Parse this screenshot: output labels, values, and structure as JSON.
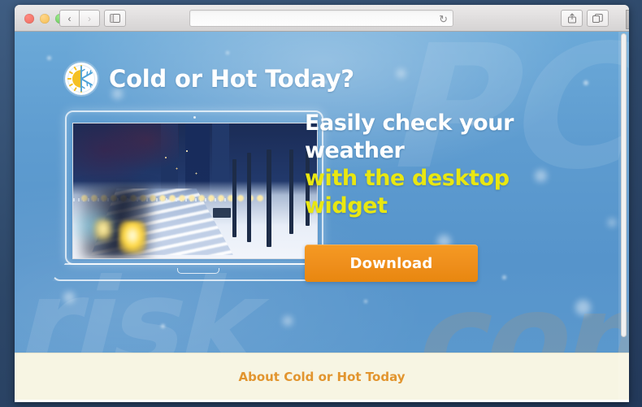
{
  "browser": {
    "window_controls": {
      "close": "close",
      "minimize": "minimize",
      "maximize": "maximize"
    },
    "back_label": "‹",
    "forward_label": "›",
    "sidebar_icon": "sidebar-icon",
    "address_value": "",
    "address_placeholder": "",
    "reload_label": "↻",
    "share_icon": "share-icon",
    "tabs_icon": "tabs-overview-icon",
    "new_tab_label": "+"
  },
  "page": {
    "brand": {
      "title": "Cold or Hot Today?",
      "logo_name": "sun-snowflake-logo"
    },
    "hero": {
      "headline_line1": "Easily check your weather",
      "headline_line2": "with the desktop widget",
      "download_label": "Download",
      "screenshot_alt": "winter night park path with street lamps"
    },
    "footer": {
      "about_label": "About Cold or Hot Today"
    },
    "watermarks": {
      "top": "PC",
      "bottom_left": "risk",
      "bottom_right": ".com"
    }
  },
  "colors": {
    "accent_orange": "#ef8f1c",
    "headline_yellow": "#e9e711",
    "page_blue": "#5e9cd0",
    "footer_cream": "#f7f5e3",
    "link_orange": "#e2952f"
  }
}
